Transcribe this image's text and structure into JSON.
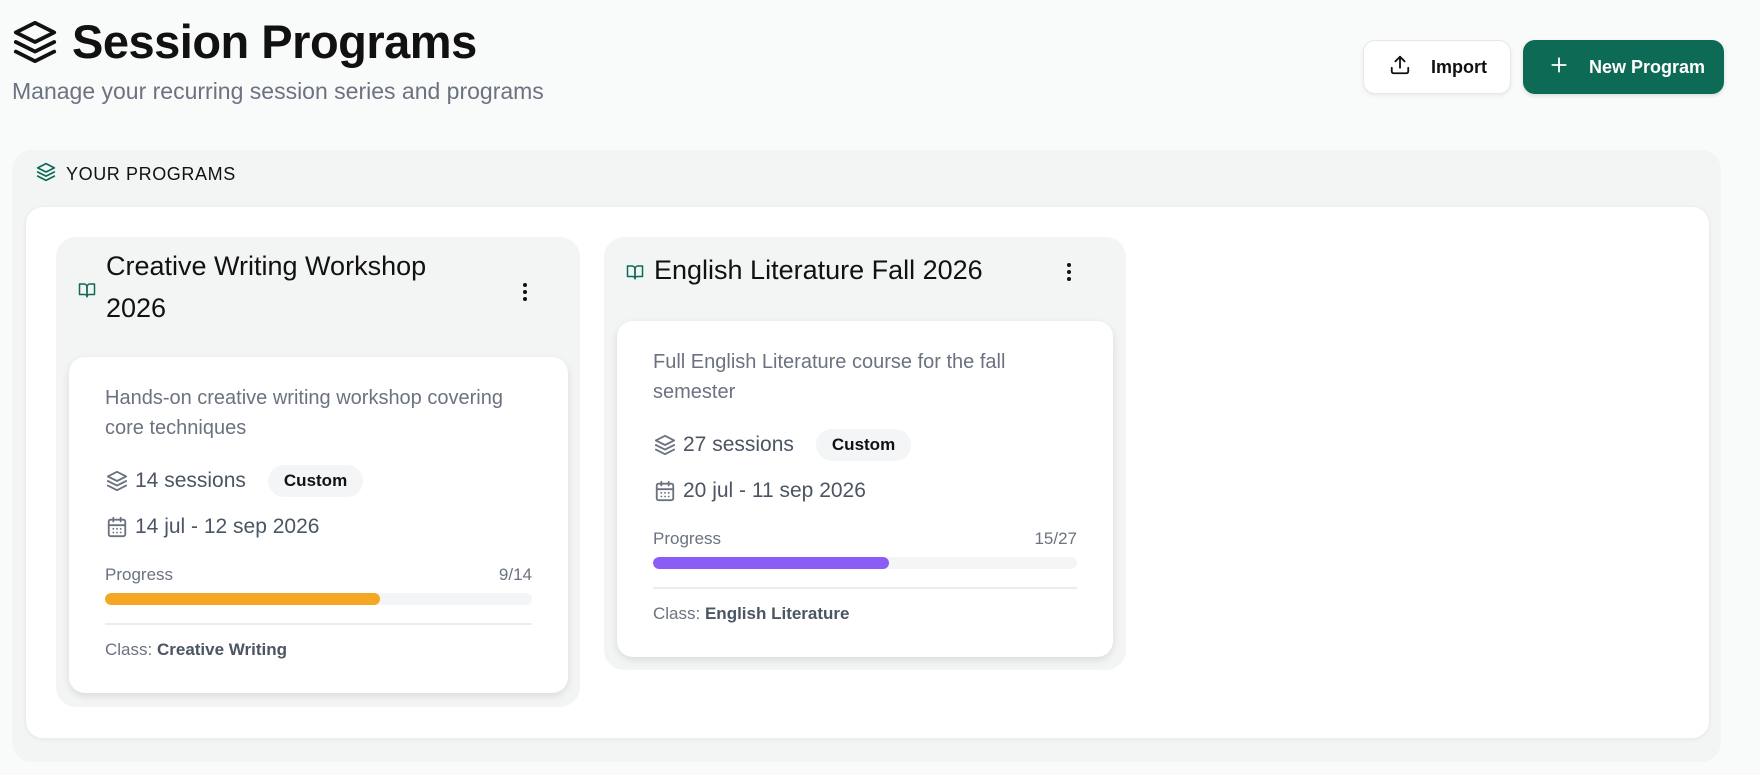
{
  "header": {
    "title": "Session Programs",
    "subtitle": "Manage your recurring session series and programs",
    "title_icon": "layers-icon"
  },
  "actions": {
    "import_label": "Import",
    "import_icon": "upload-icon",
    "new_label": "New Program",
    "new_icon": "plus-icon",
    "accent_color": "#0d6a55"
  },
  "programs_section": {
    "label": "YOUR PROGRAMS",
    "icon": "layers-icon"
  },
  "programs": [
    {
      "title": "Creative Writing Workshop 2026",
      "icon": "book-open-icon",
      "description": "Hands-on creative writing workshop covering core techniques",
      "sessions": "14 sessions",
      "badge": "Custom",
      "dates": "14 jul - 12 sep 2026",
      "progress_label": "Progress",
      "progress_text": "9/14",
      "progress_value": 0.6429,
      "progress_color": "#f5a623",
      "class_prefix": "Class:",
      "class_name": "Creative Writing"
    },
    {
      "title": "English Literature Fall 2026",
      "icon": "book-open-icon",
      "description": "Full English Literature course for the fall semester",
      "sessions": "27 sessions",
      "badge": "Custom",
      "dates": "20 jul - 11 sep 2026",
      "progress_label": "Progress",
      "progress_text": "15/27",
      "progress_value": 0.5556,
      "progress_color": "#8b5cf6",
      "class_prefix": "Class:",
      "class_name": "English Literature"
    }
  ]
}
